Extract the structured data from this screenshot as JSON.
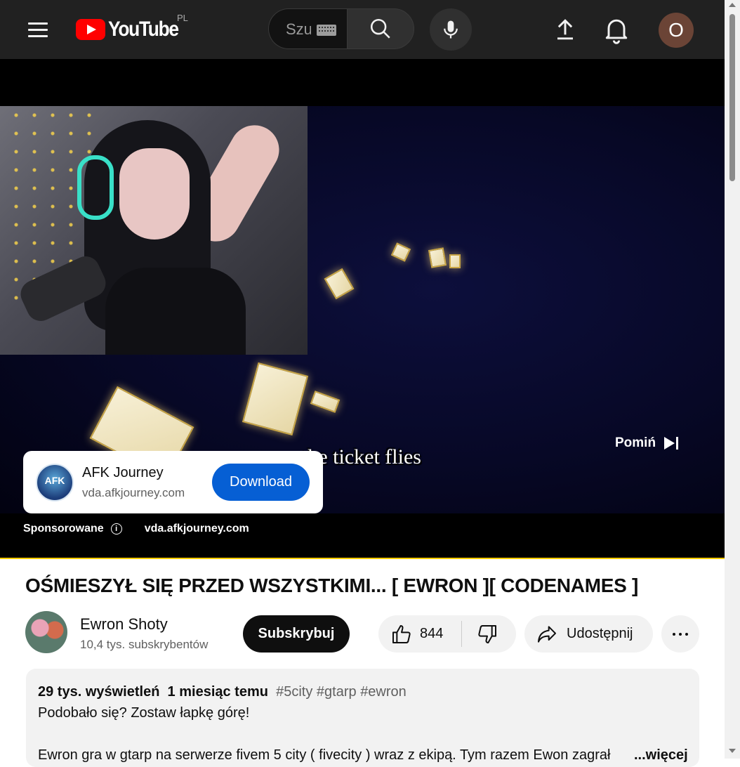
{
  "header": {
    "logo_text": "YouTube",
    "country_code": "PL",
    "search_placeholder": "Szukaj",
    "avatar_letter": "O"
  },
  "player": {
    "subtitle": "the ticket flies",
    "skip_label": "Pomiń",
    "ad": {
      "logo_text": "AFK",
      "title": "AFK Journey",
      "url": "vda.afkjourney.com",
      "cta": "Download"
    },
    "sponsored_label": "Sponsorowane",
    "sponsored_url": "vda.afkjourney.com",
    "ad_progress": 1.0
  },
  "video": {
    "title": "OŚMIESZYŁ SIĘ PRZED WSZYSTKIMI... [ EWRON ][ CODENAMES ]",
    "channel_name": "Ewron Shoty",
    "subscribers": "10,4 tys. subskrybentów",
    "subscribe_label": "Subskrybuj",
    "likes": "844",
    "share_label": "Udostępnij"
  },
  "description": {
    "views": "29 tys. wyświetleń",
    "age": "1 miesiąc temu",
    "tags": [
      "#5city",
      "#gtarp",
      "#ewron"
    ],
    "line1": "Podobało się? Zostaw łapkę górę!",
    "line2": "Ewron gra w gtarp na serwerze fivem 5 city ( fivecity ) wraz z ekipą. Tym razem Ewon zagrał",
    "more_label": "...więcej"
  },
  "colors": {
    "brand_red": "#ff0000",
    "ad_button_blue": "#065fd4",
    "ad_progress_yellow": "#ffcc00"
  }
}
